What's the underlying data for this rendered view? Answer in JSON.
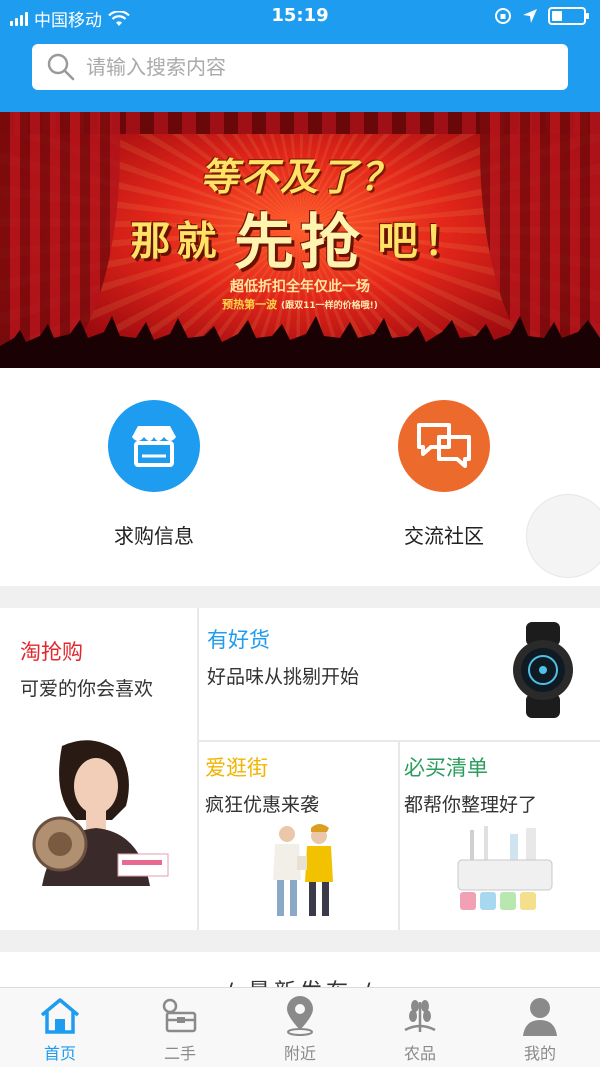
{
  "status_bar": {
    "carrier": "中国移动",
    "time": "15:19"
  },
  "search": {
    "placeholder": "请输入搜索内容"
  },
  "banner": {
    "line1": "等不及了？",
    "line2_a": "那就",
    "line2_b": "先抢",
    "line2_c": "吧！",
    "line3": "超低折扣全年仅此一场",
    "line4": "预热第一波",
    "line4_note": "(跟双11一样的价格哦!)"
  },
  "categories": [
    {
      "label": "求购信息",
      "icon": "store-icon",
      "color": "#1e9cf0"
    },
    {
      "label": "交流社区",
      "icon": "chat-icon",
      "color": "#ec6a2c"
    }
  ],
  "promo": {
    "taoqianggou": {
      "title": "淘抢购",
      "subtitle": "可爱的你会喜欢",
      "color": "#e0282e"
    },
    "youhaohuo": {
      "title": "有好货",
      "subtitle": "好品味从挑剔开始",
      "color": "#1e9cf0"
    },
    "aiguangjie": {
      "title": "爱逛街",
      "subtitle": "疯狂优惠来袭",
      "color": "#f0b400"
    },
    "bimaiqingdan": {
      "title": "必买清单",
      "subtitle": "都帮你整理好了",
      "color": "#2a9d5c"
    }
  },
  "latest": {
    "title": "/ 最新发布 /"
  },
  "tabs": [
    {
      "label": "首页",
      "icon": "home-icon",
      "active": true
    },
    {
      "label": "二手",
      "icon": "secondhand-icon",
      "active": false
    },
    {
      "label": "附近",
      "icon": "location-icon",
      "active": false
    },
    {
      "label": "农品",
      "icon": "wheat-icon",
      "active": false
    },
    {
      "label": "我的",
      "icon": "user-icon",
      "active": false
    }
  ]
}
